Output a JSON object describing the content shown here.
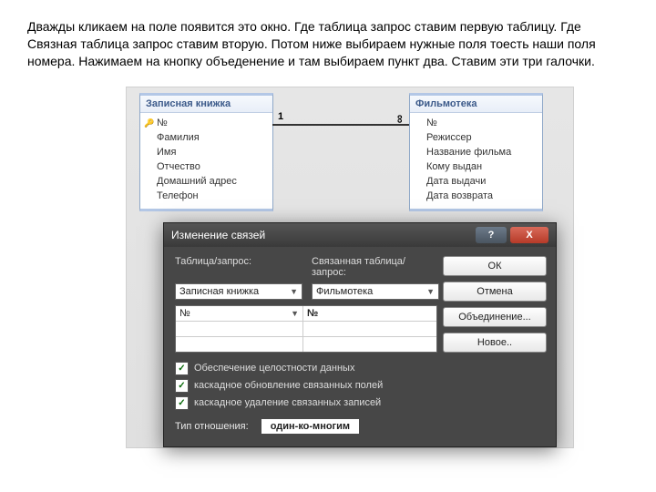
{
  "instruction": "Дважды кликаем на поле появится это окно. Где таблица запрос ставим первую таблицу. Где Связная таблица запрос ставим вторую. Потом ниже выбираем нужные поля тоесть наши поля номера. Нажимаем на кнопку объеденение и там выбираем пункт два. Ставим эти три галочки.",
  "entities": {
    "left": {
      "title": "Записная книжка",
      "fields": [
        "№",
        "Фамилия",
        "Имя",
        "Отчество",
        "Домашний адрес",
        "Телефон"
      ]
    },
    "right": {
      "title": "Фильмотека",
      "fields": [
        "№",
        "Режиссер",
        "Название фильма",
        "Кому выдан",
        "Дата выдачи",
        "Дата возврата"
      ]
    }
  },
  "relation": {
    "one": "1",
    "many": "∞"
  },
  "dialog": {
    "title": "Изменение связей",
    "help": "?",
    "close": "X",
    "labels": {
      "table_query": "Таблица/запрос:",
      "related_table_query": "Связанная таблица/запрос:"
    },
    "combos": {
      "left": "Записная книжка",
      "right": "Фильмотека"
    },
    "grid": {
      "left_field": "№",
      "right_field": "№"
    },
    "checks": {
      "c1": "Обеспечение целостности данных",
      "c2": "каскадное обновление связанных полей",
      "c3": "каскадное удаление связанных записей"
    },
    "rel_type_label": "Тип отношения:",
    "rel_type_value": "один-ко-многим",
    "buttons": {
      "ok": "ОК",
      "cancel": "Отмена",
      "join": "Объединение...",
      "new": "Новое.."
    }
  }
}
